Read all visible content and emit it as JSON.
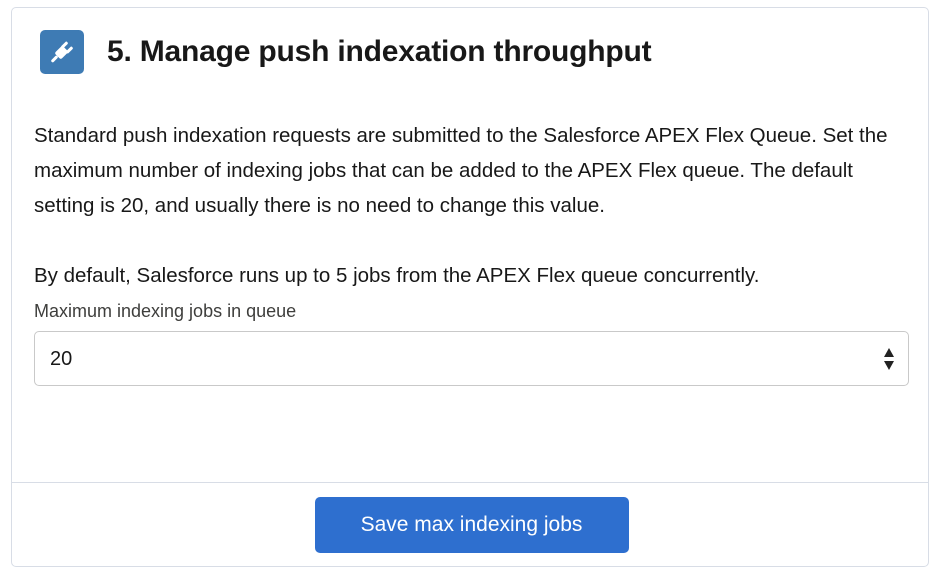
{
  "card": {
    "title": "5. Manage push indexation throughput",
    "icon": "plug-icon",
    "accent_color": "#3e7bb4"
  },
  "description": {
    "paragraph_1": "Standard push indexation requests are submitted to the Salesforce APEX Flex Queue. Set the maximum number of indexing jobs that can be added to the APEX Flex queue. The default setting is 20, and usually there is no need to change this value.",
    "paragraph_2": "By default, Salesforce runs up to 5 jobs from the APEX Flex queue concurrently."
  },
  "max_jobs_field": {
    "label": "Maximum indexing jobs in queue",
    "value": "20"
  },
  "footer": {
    "save_label": "Save max indexing jobs",
    "button_color": "#2e6fcf"
  }
}
